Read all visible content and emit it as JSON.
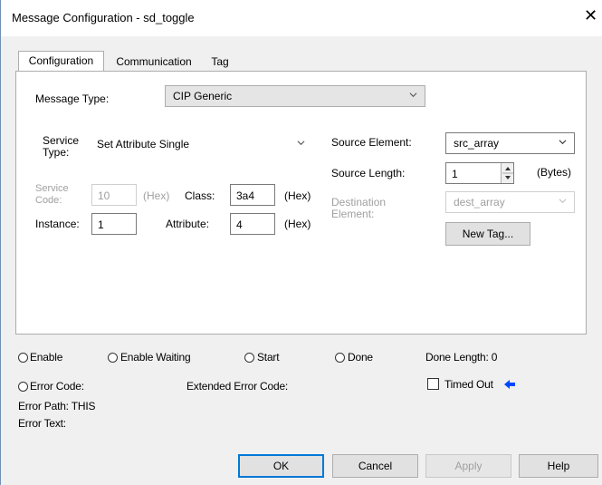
{
  "window": {
    "title": "Message Configuration - sd_toggle",
    "close_glyph": "✕"
  },
  "tabs": [
    {
      "label": "Configuration",
      "active": true
    },
    {
      "label": "Communication",
      "active": false
    },
    {
      "label": "Tag",
      "active": false
    }
  ],
  "config": {
    "message_type_label": "Message Type:",
    "message_type_value": "CIP Generic",
    "service_type_label": "Service\nType:",
    "service_type_value": "Set Attribute Single",
    "service_code_label": "Service\nCode:",
    "service_code_value": "10",
    "service_code_unit": "(Hex)",
    "class_label": "Class:",
    "class_value": "3a4",
    "class_unit": "(Hex)",
    "instance_label": "Instance:",
    "instance_value": "1",
    "attribute_label": "Attribute:",
    "attribute_value": "4",
    "attribute_unit": "(Hex)",
    "source_element_label": "Source Element:",
    "source_element_value": "src_array",
    "source_length_label": "Source Length:",
    "source_length_value": "1",
    "source_length_unit": "(Bytes)",
    "destination_element_label": "Destination\nElement:",
    "destination_element_value": "dest_array",
    "new_tag_label": "New Tag..."
  },
  "status": {
    "enable": "Enable",
    "enable_waiting": "Enable Waiting",
    "start": "Start",
    "done": "Done",
    "done_length": "Done Length: 0",
    "error_code": "Error Code:",
    "extended_error_code": "Extended Error Code:",
    "timed_out": "Timed Out",
    "timed_out_arrow_color": "#0047ff",
    "error_path": "Error Path: THIS",
    "error_text": "Error Text:"
  },
  "buttons": {
    "ok": "OK",
    "cancel": "Cancel",
    "apply": "Apply",
    "help": "Help"
  }
}
